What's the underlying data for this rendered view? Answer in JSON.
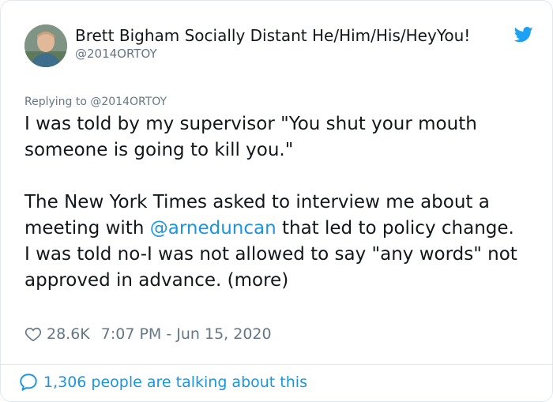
{
  "author": {
    "display_name": "Brett Bigham Socially Distant He/Him/His/HeyYou!",
    "handle": "@2014ORTOY",
    "avatar_icon": "person-photo-avatar",
    "verified_icon": "twitter-bird-icon"
  },
  "reply": {
    "text": "Replying to @2014ORTOY"
  },
  "tweet": {
    "line1": "I was told by my supervisor \"You shut your mouth someone is going to kill you.\"",
    "line2_before": "The New York Times asked to interview me about a meeting with ",
    "mention": "@arneduncan",
    "line2_after": " that led to policy change.",
    "line3": "I was told no-I was not allowed to say \"any words\" not approved in advance. (more)"
  },
  "meta": {
    "likes": "28.6K",
    "timestamp": "7:07 PM - Jun 15, 2020"
  },
  "footer": {
    "talking_text": "1,306 people are talking about this"
  },
  "colors": {
    "link": "#1b95e0",
    "muted": "#657786",
    "text": "#14171a",
    "border": "#e1e8ed"
  }
}
